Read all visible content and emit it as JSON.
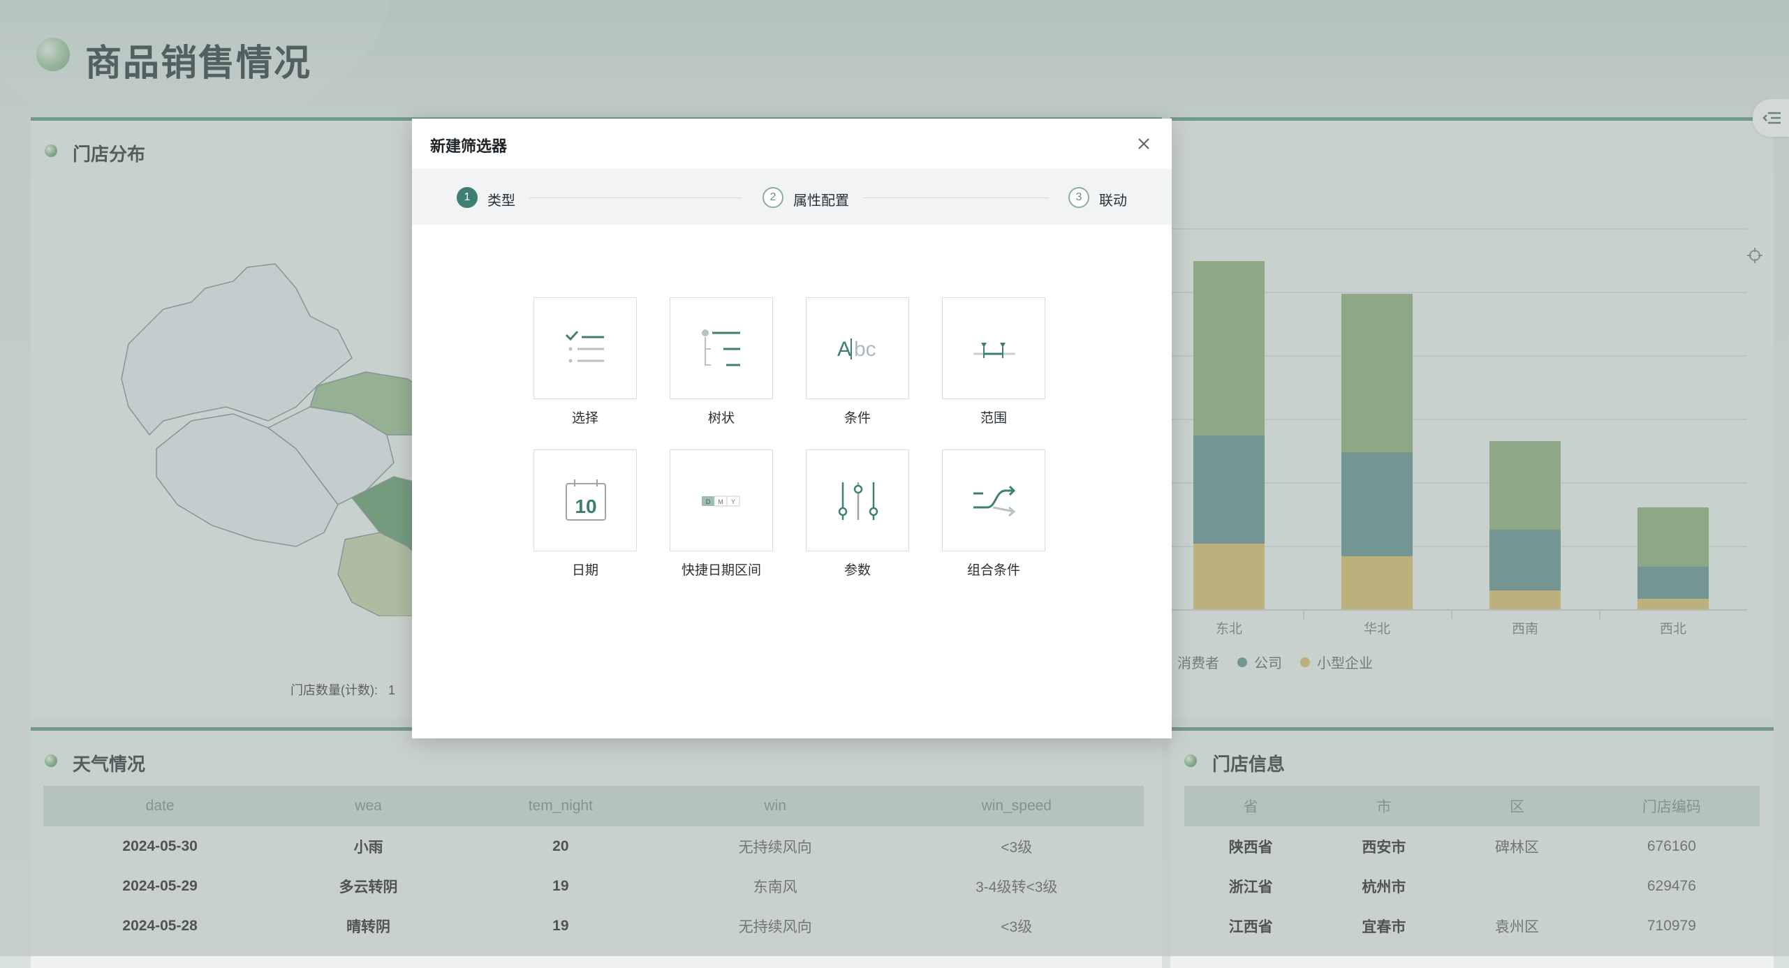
{
  "page": {
    "title": "商品销售情况"
  },
  "panels": {
    "store_distribution": {
      "title": "门店分布",
      "legend_label": "门店数量(计数):",
      "legend_min": "1"
    },
    "weather": {
      "title": "天气情况"
    },
    "store_info": {
      "title": "门店信息"
    }
  },
  "chart_data": {
    "type": "bar",
    "stacked": true,
    "categories": [
      "东北",
      "华北",
      "西南",
      "西北"
    ],
    "series": [
      {
        "name": "小型企业",
        "values": [
          62,
          50,
          18,
          10
        ],
        "color": "#d8b865"
      },
      {
        "name": "公司",
        "values": [
          102,
          98,
          57,
          30
        ],
        "color": "#5c8c88"
      },
      {
        "name": "消费者",
        "values": [
          165,
          150,
          84,
          56
        ],
        "color": "#88aa74"
      }
    ],
    "legend_visible": [
      "消费者",
      "公司",
      "小型企业"
    ],
    "legend": "bottom",
    "grid": true
  },
  "weather_table": {
    "headers": [
      "date",
      "wea",
      "tem_night",
      "win",
      "win_speed"
    ],
    "rows": [
      [
        "2024-05-30",
        "小雨",
        "20",
        "无持续风向",
        "<3级"
      ],
      [
        "2024-05-29",
        "多云转阴",
        "19",
        "东南风",
        "3-4级转<3级"
      ],
      [
        "2024-05-28",
        "晴转阴",
        "19",
        "无持续风向",
        "<3级"
      ]
    ]
  },
  "store_table": {
    "headers": [
      "省",
      "市",
      "区",
      "门店编码"
    ],
    "rows": [
      [
        "陕西省",
        "西安市",
        "碑林区",
        "676160"
      ],
      [
        "浙江省",
        "杭州市",
        "",
        "629476"
      ],
      [
        "江西省",
        "宜春市",
        "袁州区",
        "710979"
      ]
    ]
  },
  "modal": {
    "title": "新建筛选器",
    "steps": [
      {
        "num": "1",
        "label": "类型"
      },
      {
        "num": "2",
        "label": "属性配置"
      },
      {
        "num": "3",
        "label": "联动"
      }
    ],
    "types": [
      {
        "label": "选择",
        "icon": "checklist-icon"
      },
      {
        "label": "树状",
        "icon": "tree-icon"
      },
      {
        "label": "条件",
        "icon": "text-condition-icon"
      },
      {
        "label": "范围",
        "icon": "range-icon"
      },
      {
        "label": "日期",
        "icon": "calendar-icon",
        "calendar_day": "10"
      },
      {
        "label": "快捷日期区间",
        "icon": "quick-date-icon",
        "glyphs": [
          "D",
          "M",
          "Y"
        ]
      },
      {
        "label": "参数",
        "icon": "sliders-icon"
      },
      {
        "label": "组合条件",
        "icon": "combine-icon"
      }
    ],
    "icon_texts": {
      "abc_a": "A",
      "abc_rest": "bc"
    }
  },
  "colors": {
    "accent": "#3d7f73",
    "accent_light": "#8aaea5",
    "panel_border": "#5b8f86"
  }
}
